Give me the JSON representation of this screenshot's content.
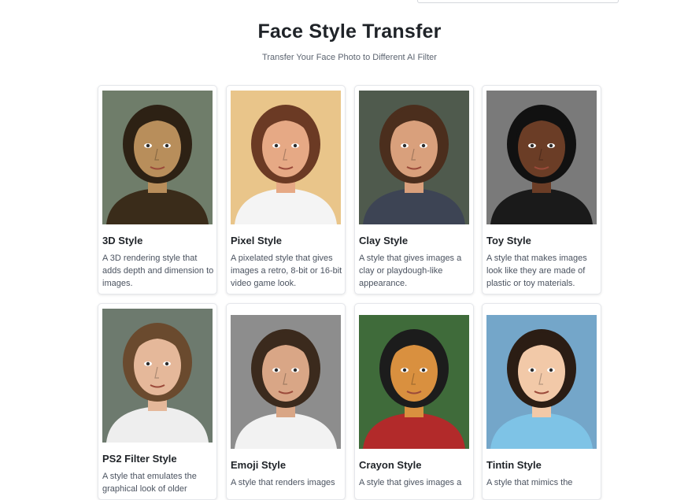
{
  "header": {
    "title": "Face Style Transfer",
    "subtitle": "Transfer Your Face Photo to Different AI Filter"
  },
  "styles": [
    {
      "title": "3D Style",
      "description": "A 3D rendering style that adds depth and dimension to images.",
      "icon": "portrait-mona-lisa",
      "bg": "#6f7d6a",
      "skin": "#b88e5b",
      "hair": "#2d2114",
      "top": "#3a2c1a"
    },
    {
      "title": "Pixel Style",
      "description": "A pixelated style that gives images a retro, 8-bit or 16-bit video game look.",
      "icon": "portrait-pixel-woman",
      "bg": "#e9c58a",
      "skin": "#e6a985",
      "hair": "#6b3a24",
      "top": "#f4f4f4"
    },
    {
      "title": "Clay Style",
      "description": "A style that gives images a clay or playdough-like appearance.",
      "icon": "portrait-clay-boy",
      "bg": "#4f5a4d",
      "skin": "#d9a07c",
      "hair": "#4b2e1d",
      "top": "#3d4454"
    },
    {
      "title": "Toy Style",
      "description": "A style that makes images look like they are made of plastic or toy materials.",
      "icon": "portrait-toy-woman",
      "bg": "#7a7a7a",
      "skin": "#6b3d26",
      "hair": "#111111",
      "top": "#1a1a1a"
    },
    {
      "title": "PS2 Filter Style",
      "description": "A style that emulates the graphical look of older",
      "icon": "portrait-ps2-woman",
      "bg": "#6d7a6e",
      "skin": "#e5b89a",
      "hair": "#6a4a2e",
      "top": "#eeeeee"
    },
    {
      "title": "Emoji Style",
      "description": "A style that renders images",
      "icon": "portrait-emoji-man",
      "bg": "#8d8d8d",
      "skin": "#d9a686",
      "hair": "#3b2a1d",
      "top": "#f2f2f2"
    },
    {
      "title": "Crayon Style",
      "description": "A style that gives images a",
      "icon": "portrait-crayon-man",
      "bg": "#3f6b3a",
      "skin": "#d9903f",
      "hair": "#1c1c1c",
      "top": "#b22a2a"
    },
    {
      "title": "Tintin Style",
      "description": "A style that mimics the",
      "icon": "portrait-tintin-woman",
      "bg": "#74a6c9",
      "skin": "#f2c9a8",
      "hair": "#2b1d14",
      "top": "#7ec3e6"
    }
  ]
}
